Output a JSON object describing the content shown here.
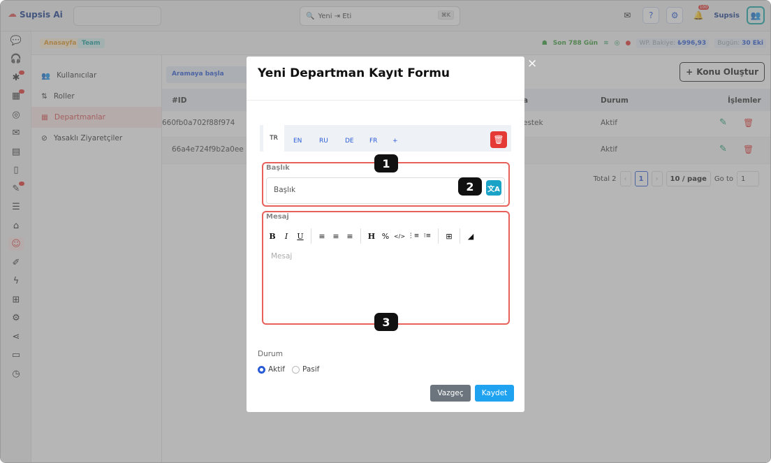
{
  "app": {
    "name": "Supsis Ai"
  },
  "topbar": {
    "command_placeholder": "Yeni ⇥ Eti",
    "shortcut": "⌘K",
    "user_name": "Supsis",
    "notification_badge": "100"
  },
  "breadcrumb": {
    "home": "Anasayfa",
    "team": "Team"
  },
  "status": {
    "days": "Son 788 Gün",
    "balance_label": "WP. Bakiye:",
    "balance_value": "₺996,93",
    "today_label": "Bugün:",
    "today_value": "30 Eki"
  },
  "nav": {
    "items": [
      {
        "icon": "users-icon",
        "glyph": "👥",
        "label": "Kullanıcılar"
      },
      {
        "icon": "roles-icon",
        "glyph": "⇅",
        "label": "Roller"
      },
      {
        "icon": "departments-icon",
        "glyph": "▦",
        "label": "Departmanlar"
      },
      {
        "icon": "ban-icon",
        "glyph": "⊘",
        "label": "Yasaklı Ziyaretçiler"
      }
    ]
  },
  "list": {
    "search_label": "Aramaya başla",
    "create_button": "Konu Oluştur",
    "columns": {
      "id": "#ID",
      "name": "a",
      "status": "Durum",
      "actions": "İşlemler"
    },
    "rows": [
      {
        "id": "660fb0a702f88f974",
        "name": "estek",
        "status": "Aktif"
      },
      {
        "id": "66a4e724f9b2a0ee",
        "name": "",
        "status": "Aktif"
      }
    ],
    "pager": {
      "total": "Total 2",
      "current": "1",
      "size": "10 / page",
      "goto_label": "Go to",
      "goto_value": "1"
    }
  },
  "modal": {
    "title": "Yeni Departman Kayıt Formu",
    "close": "×",
    "languages": [
      "TR",
      "EN",
      "RU",
      "DE",
      "FR",
      "+"
    ],
    "title_label": "Başlık",
    "title_value": "Başlık",
    "translate_glyph": "文A",
    "message_label": "Mesaj",
    "message_placeholder": "Mesaj",
    "toolbar": [
      "B",
      "I",
      "U",
      "≡",
      "≡",
      "≡",
      "H",
      "%",
      "</>",
      "⋮≡",
      "⁝≡",
      "⊞",
      "◢"
    ],
    "status_label": "Durum",
    "status_options": [
      "Aktif",
      "Pasif"
    ],
    "selected_status": "Aktif",
    "cancel_button": "Vazgeç",
    "save_button": "Kaydet"
  },
  "annotations": [
    "1",
    "2",
    "3"
  ]
}
